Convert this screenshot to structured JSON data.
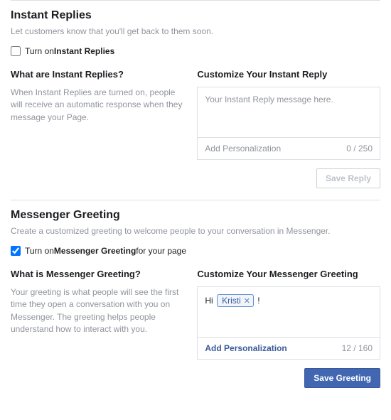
{
  "instantReplies": {
    "title": "Instant Replies",
    "subtitle": "Let customers know that you'll get back to them soon.",
    "toggle": {
      "prefix": "Turn on ",
      "bold": "Instant Replies"
    },
    "left": {
      "heading": "What are Instant Replies?",
      "desc": "When Instant Replies are turned on, people will receive an automatic response when they message your Page."
    },
    "right": {
      "heading": "Customize Your Instant Reply",
      "placeholder": "Your Instant Reply message here.",
      "addLabel": "Add Personalization",
      "counter": "0 / 250",
      "saveLabel": "Save Reply"
    }
  },
  "messengerGreeting": {
    "title": "Messenger Greeting",
    "subtitle": "Create a customized greeting to welcome people to your conversation in Messenger.",
    "toggle": {
      "prefix": "Turn on ",
      "bold": "Messenger Greeting",
      "suffix": " for your page"
    },
    "left": {
      "heading": "What is Messenger Greeting?",
      "desc": "Your greeting is what people will see the first time they open a conversation with you on Messenger. The greeting helps people understand how to interact with you."
    },
    "right": {
      "heading": "Customize Your Messenger Greeting",
      "hi": "Hi ",
      "token": "Kristi",
      "after": " !",
      "addLabel": "Add Personalization",
      "counter": "12 / 160",
      "saveLabel": "Save Greeting"
    }
  }
}
